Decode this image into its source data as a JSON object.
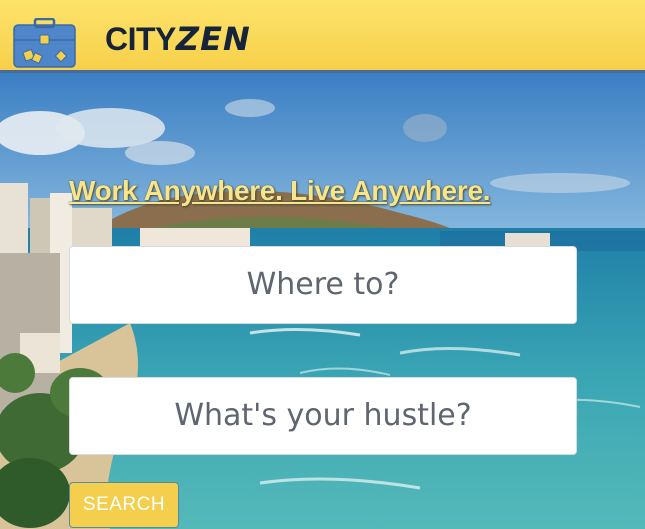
{
  "header": {
    "logo_icon": "briefcase-icon",
    "brand_prefix": "CITY",
    "brand_suffix": "ZEN"
  },
  "hero": {
    "tagline": "Work Anywhere. Live Anywhere.",
    "background": "beach-city-photo"
  },
  "search": {
    "where_placeholder": "Where to?",
    "hustle_placeholder": "What's your hustle?",
    "button_label": "SEARCH"
  },
  "colors": {
    "header_yellow": "#f7d04a",
    "header_border": "#4b6a9b",
    "brand_text": "#16243a",
    "tagline_yellow": "#f8e58a",
    "button_yellow": "#f4cf4e"
  }
}
